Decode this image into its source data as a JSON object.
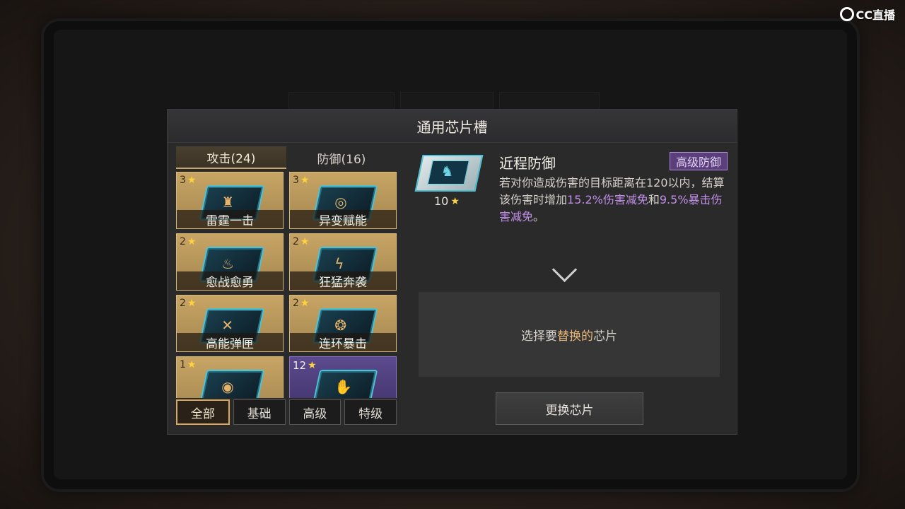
{
  "watermark": {
    "brand": "CC直播"
  },
  "dialog": {
    "title": "通用芯片槽"
  },
  "category_tabs": [
    {
      "label": "攻击(24)",
      "active": true
    },
    {
      "label": "防御(16)",
      "active": false
    }
  ],
  "chips": [
    {
      "stars": "3",
      "name": "雷霆一击",
      "rarity": "gold"
    },
    {
      "stars": "3",
      "name": "异变赋能",
      "rarity": "gold"
    },
    {
      "stars": "2",
      "name": "愈战愈勇",
      "rarity": "gold"
    },
    {
      "stars": "2",
      "name": "狂猛奔袭",
      "rarity": "gold"
    },
    {
      "stars": "2",
      "name": "高能弹匣",
      "rarity": "gold"
    },
    {
      "stars": "2",
      "name": "连环暴击",
      "rarity": "gold"
    },
    {
      "stars": "1",
      "name": "",
      "rarity": "gold"
    },
    {
      "stars": "12",
      "name": "",
      "rarity": "purple"
    }
  ],
  "filters": [
    {
      "label": "全部",
      "active": true
    },
    {
      "label": "基础",
      "active": false
    },
    {
      "label": "高级",
      "active": false
    },
    {
      "label": "特级",
      "active": false
    }
  ],
  "detail": {
    "level": "10",
    "title": "近程防御",
    "badge": "高级防御",
    "desc_1": "若对你造成伤害的目标距离在120以内，结算该伤害时增加",
    "desc_hl_1": "15.2%伤害减免",
    "desc_2": "和",
    "desc_hl_2": "9.5%暴击伤害减免",
    "desc_3": "。"
  },
  "replace_slot": {
    "prefix": "选择要",
    "accent": "替换的",
    "suffix": "芯片"
  },
  "swap_button": {
    "label": "更换芯片"
  },
  "colors": {
    "gold_card": "#c8a565",
    "purple_card": "#5c4a8e",
    "highlight": "#c18fe6",
    "badge": "#5b3f7c"
  }
}
